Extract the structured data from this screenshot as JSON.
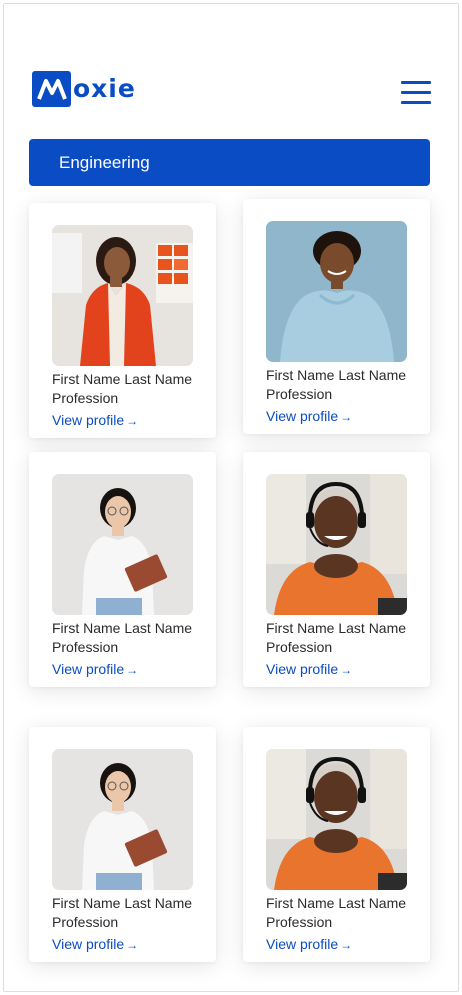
{
  "header": {
    "logo_text": "oxie",
    "logo_letter": "M",
    "brand_color": "#0a4cc4"
  },
  "category": {
    "label": "Engineering"
  },
  "cards": [
    {
      "name": "First Name Last Name",
      "profession": "Profession",
      "link": "View profile",
      "arrow": "→"
    },
    {
      "name": "First Name Last Name",
      "profession": "Profession",
      "link": "View profile",
      "arrow": "→"
    },
    {
      "name": "First Name Last Name",
      "profession": "Profession",
      "link": "View profile",
      "arrow": "→"
    },
    {
      "name": "First Name Last Name",
      "profession": "Profession",
      "link": "View profile",
      "arrow": "→"
    },
    {
      "name": "First Name Last Name",
      "profession": "Profession",
      "link": "View profile",
      "arrow": "→"
    },
    {
      "name": "First Name Last Name",
      "profession": "Profession",
      "link": "View profile",
      "arrow": "→"
    }
  ]
}
